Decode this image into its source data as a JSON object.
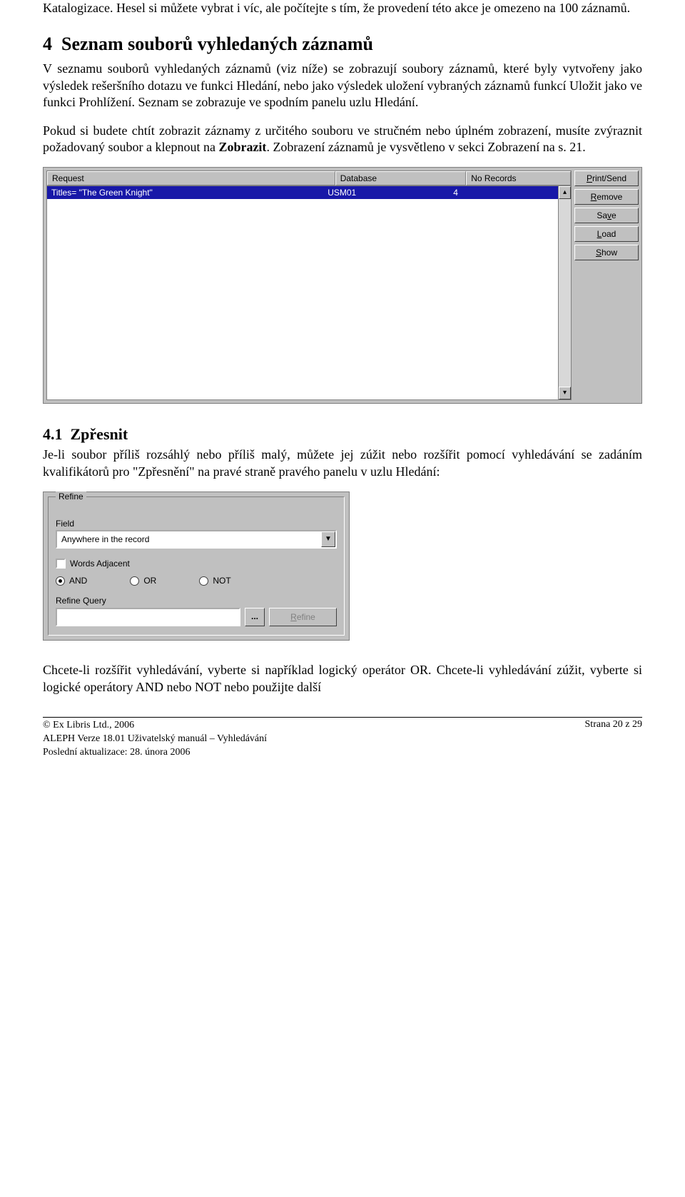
{
  "intro_para": "Katalogizace. Hesel si můžete vybrat i víc, ale počítejte s tím, že provedení této akce je omezeno na 100 záznamů.",
  "section4": {
    "number": "4",
    "title": "Seznam souborů vyhledaných záznamů"
  },
  "para_s4_1": "V seznamu souborů vyhledaných záznamů (viz níže) se zobrazují soubory záznamů, které byly vytvořeny jako výsledek rešeršního dotazu ve funkci Hledání, nebo jako výsledek uložení vybraných záznamů funkcí Uložit jako ve funkci Prohlížení. Seznam se zobrazuje ve spodním panelu uzlu Hledání.",
  "para_s4_2a": "Pokud si budete chtít zobrazit záznamy z určitého souboru ve stručném nebo úplném zobrazení, musíte zvýraznit požadovaný soubor a klepnout na ",
  "para_s4_2b_bold": "Zobrazit",
  "para_s4_2c": ". Zobrazení záznamů je vysvětleno v sekci Zobrazení na s. 21.",
  "results_table": {
    "headers": {
      "request": "Request",
      "database": "Database",
      "no_records": "No Records"
    },
    "row": {
      "request": "Titles= \"The Green Knight\"",
      "database": "USM01",
      "no_records": "4"
    }
  },
  "buttons": {
    "print_send": "Print/Send",
    "remove": "Remove",
    "save": "Save",
    "load": "Load",
    "show": "Show"
  },
  "subsection41": {
    "number": "4.1",
    "title": "Zpřesnit"
  },
  "para_s41": "Je-li soubor příliš rozsáhlý nebo příliš malý, můžete jej zúžit nebo rozšířit pomocí vyhledávání se zadáním kvalifikátorů pro \"Zpřesnění\" na pravé straně pravého panelu v uzlu Hledání:",
  "refine": {
    "legend": "Refine",
    "field_label": "Field",
    "field_value": "Anywhere in the record",
    "words_adjacent": "Words Adjacent",
    "and": "AND",
    "or": "OR",
    "not": "NOT",
    "refine_query": "Refine Query",
    "ellipsis": "...",
    "refine_btn": "Refine"
  },
  "para_after_refine": "Chcete-li rozšířit vyhledávání, vyberte si například logický operátor OR. Chcete-li vyhledávání zúžit, vyberte si logické operátory AND nebo NOT nebo použijte další",
  "footer": {
    "copyright": "© Ex Libris Ltd., 2006",
    "version": "ALEPH Verze 18.01 Uživatelský manuál – Vyhledávání",
    "updated": "Poslední aktualizace: 28. února 2006",
    "page": "Strana 20 z 29"
  }
}
